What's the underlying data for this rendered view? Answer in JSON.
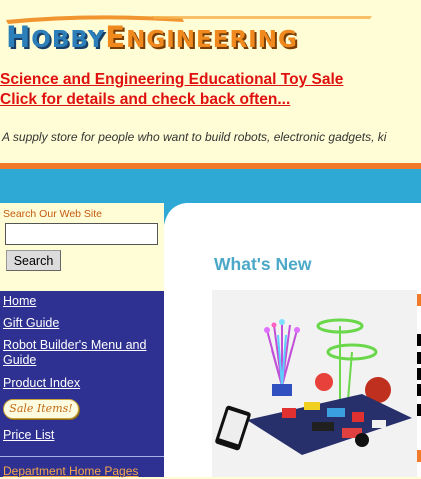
{
  "header": {
    "logo_text": "HobbyEngineering",
    "sale_link_1": "Science and Engineering Educational Toy Sale",
    "sale_link_2": "Click for details and check back often...",
    "tagline": "A supply store for people who want to build robots, electronic gadgets, ki"
  },
  "search": {
    "label": "Search Our Web Site",
    "input_value": "",
    "button_label": "Search"
  },
  "nav": {
    "items": [
      {
        "label": "Home"
      },
      {
        "label": "Gift Guide"
      },
      {
        "label": "Robot Builder's Menu and Guide"
      },
      {
        "label": "Product Index"
      },
      {
        "label": "Sale Items!"
      },
      {
        "label": "Price List"
      }
    ],
    "department_label": "Department Home Pages"
  },
  "main": {
    "heading": "What's New",
    "product_image_alt": "snap-circuits-kit"
  },
  "colors": {
    "background": "#fefdd5",
    "nav_bg": "#2e3191",
    "stripe_blue": "#2ea9d6",
    "stripe_orange": "#f07a2a",
    "sale_red": "#e01010",
    "heading_teal": "#4ba8c7"
  }
}
